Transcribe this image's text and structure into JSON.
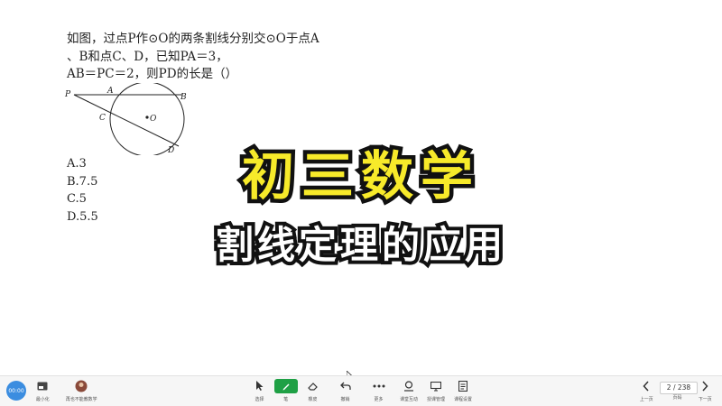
{
  "problem": {
    "line1": "如图，过点P作⊙O的两条割线分别交⊙O于点A",
    "line2": "、B和点C、D，已知PA＝3，",
    "line3": "AB＝PC＝2，则PD的长是（）"
  },
  "figure": {
    "labels": {
      "P": "P",
      "A": "A",
      "B": "B",
      "C": "C",
      "D": "D",
      "O": "O"
    }
  },
  "options": [
    "A.3",
    "B.7.5",
    "C.5",
    "D.5.5"
  ],
  "title": {
    "main": "初三数学",
    "sub": "割线定理的应用"
  },
  "taskbar": {
    "avatar_text": "00:00",
    "items": [
      {
        "label": "最小化",
        "icon": "minimize-icon"
      },
      {
        "label": "再也不能教数学",
        "icon": "user-avatar-icon"
      },
      {
        "label": "选择",
        "icon": "pointer-icon"
      },
      {
        "label": "笔",
        "icon": "pen-icon"
      },
      {
        "label": "橡皮",
        "icon": "eraser-icon"
      },
      {
        "label": "撤销",
        "icon": "undo-icon"
      },
      {
        "label": "更多",
        "icon": "more-icon"
      },
      {
        "label": "课堂互动",
        "icon": "interact-icon"
      },
      {
        "label": "授课管理",
        "icon": "manage-icon"
      },
      {
        "label": "课程设置",
        "icon": "settings-icon"
      },
      {
        "label": "上一页",
        "icon": "prev-icon"
      },
      {
        "label": "页码",
        "icon": "page-icon"
      },
      {
        "label": "下一页",
        "icon": "next-icon"
      }
    ],
    "page_indicator": "2 / 238"
  },
  "colors": {
    "title_fill": "#f7ea2a",
    "title_stroke": "#111111",
    "sub_fill": "#ffffff",
    "pen_active": "#1fa045",
    "avatar_bg": "#3b8de0"
  }
}
